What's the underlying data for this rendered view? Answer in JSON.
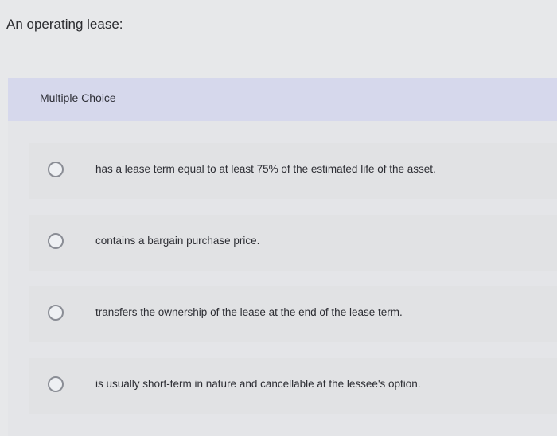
{
  "question": {
    "text": "An operating lease:"
  },
  "multiple_choice": {
    "label": "Multiple Choice",
    "options": [
      {
        "text": "has a lease term equal to at least 75% of the estimated life of the asset."
      },
      {
        "text": "contains a bargain purchase price."
      },
      {
        "text": "transfers the ownership of the lease at the end of the lease term."
      },
      {
        "text": "is usually short-term in nature and cancellable at the lessee's option."
      }
    ]
  },
  "colors": {
    "background": "#e7e8ea",
    "header_band": "#d6d8ec",
    "option_bg": "#e1e2e4",
    "radio_border": "#8a8d95",
    "text": "#2a2a2c"
  }
}
